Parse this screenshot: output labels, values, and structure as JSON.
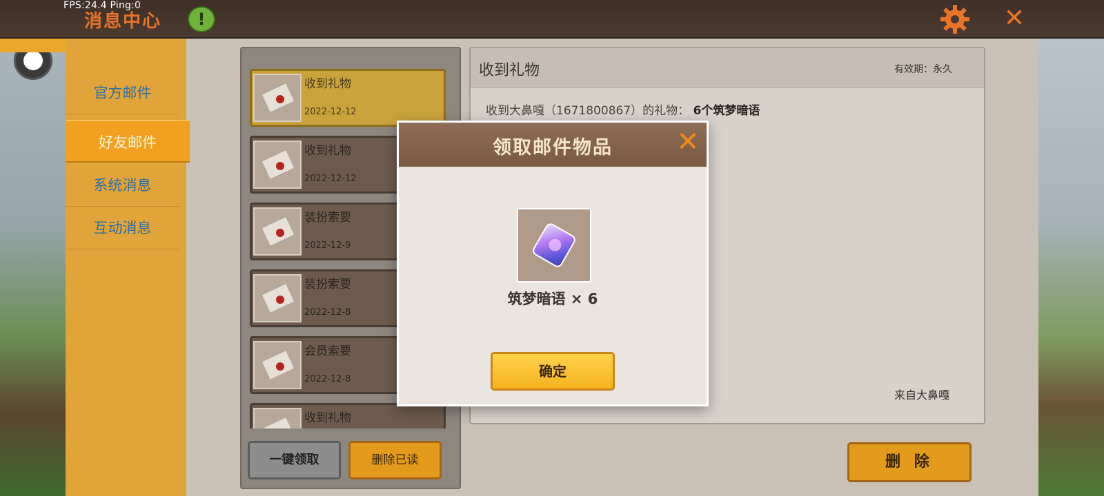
{
  "app": {
    "fps_text": "FPS:24.4  Ping:0",
    "title": "消息中心",
    "alert_glyph": "!",
    "close_glyph": "✕"
  },
  "icons": {
    "settings": "gear-icon",
    "close": "close-icon",
    "alert": "exclamation-icon",
    "record": "record-dot-icon",
    "mail": "envelope-icon",
    "item": "gem-card-icon"
  },
  "colors": {
    "accent_orange": "#e8742a",
    "tab_active": "#f2a020",
    "button_gold": "#e39b1d",
    "topbar": "#4b3a2f"
  },
  "sidebar": {
    "items": [
      {
        "label": "官方邮件"
      },
      {
        "label": "好友邮件"
      },
      {
        "label": "系统消息"
      },
      {
        "label": "互动消息"
      }
    ],
    "active_index": 1
  },
  "mail_list": {
    "items": [
      {
        "title": "收到礼物",
        "date": "2022-12-12"
      },
      {
        "title": "收到礼物",
        "date": "2022-12-12"
      },
      {
        "title": "装扮索要",
        "date": "2022-12-9"
      },
      {
        "title": "装扮索要",
        "date": "2022-12-8"
      },
      {
        "title": "会员索要",
        "date": "2022-12-8"
      },
      {
        "title": "收到礼物",
        "date": ""
      }
    ],
    "selected_index": 0
  },
  "footer": {
    "claim_all": "一键领取",
    "delete_read": "删除已读",
    "delete": "删 除"
  },
  "detail": {
    "title": "收到礼物",
    "validity": "有效期：永久",
    "body_prefix": "收到大鼻嘎（1671800867）的礼物：",
    "body_bold": "6个筑梦暗语",
    "sender": "来自大鼻嘎"
  },
  "modal": {
    "title": "领取邮件物品",
    "close_glyph": "✕",
    "item_name": "筑梦暗语 × 6",
    "confirm": "确定"
  }
}
